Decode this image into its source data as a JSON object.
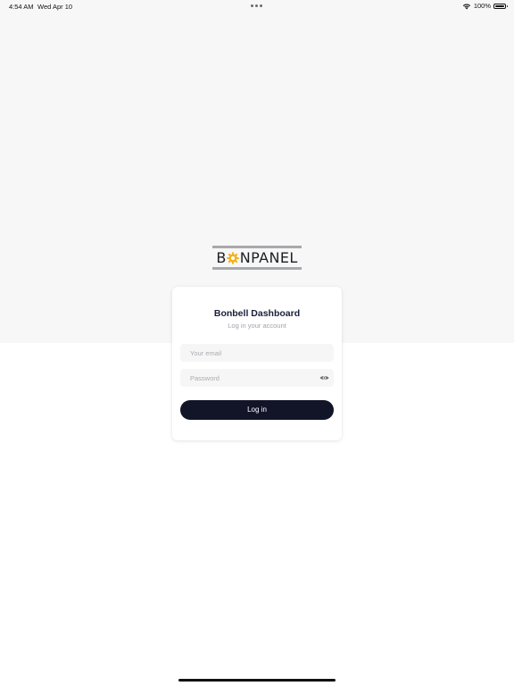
{
  "status_bar": {
    "time": "4:54 AM",
    "date": "Wed Apr 10",
    "battery": "100%"
  },
  "logo": {
    "letter_first": "B",
    "letters_rest": "NPANEL",
    "gear_color": "#f3b21a",
    "bar_color": "#a7a9ac"
  },
  "login_card": {
    "title": "Bonbell Dashboard",
    "subtitle": "Log in your account",
    "email_placeholder": "Your email",
    "email_value": "",
    "password_placeholder": "Password",
    "password_value": "",
    "password_toggle_icon": "eye-icon",
    "submit_label": "Log in"
  },
  "colors": {
    "primary_button": "#121528",
    "title": "#1b1f3a",
    "background_top": "#f7f7f7"
  }
}
